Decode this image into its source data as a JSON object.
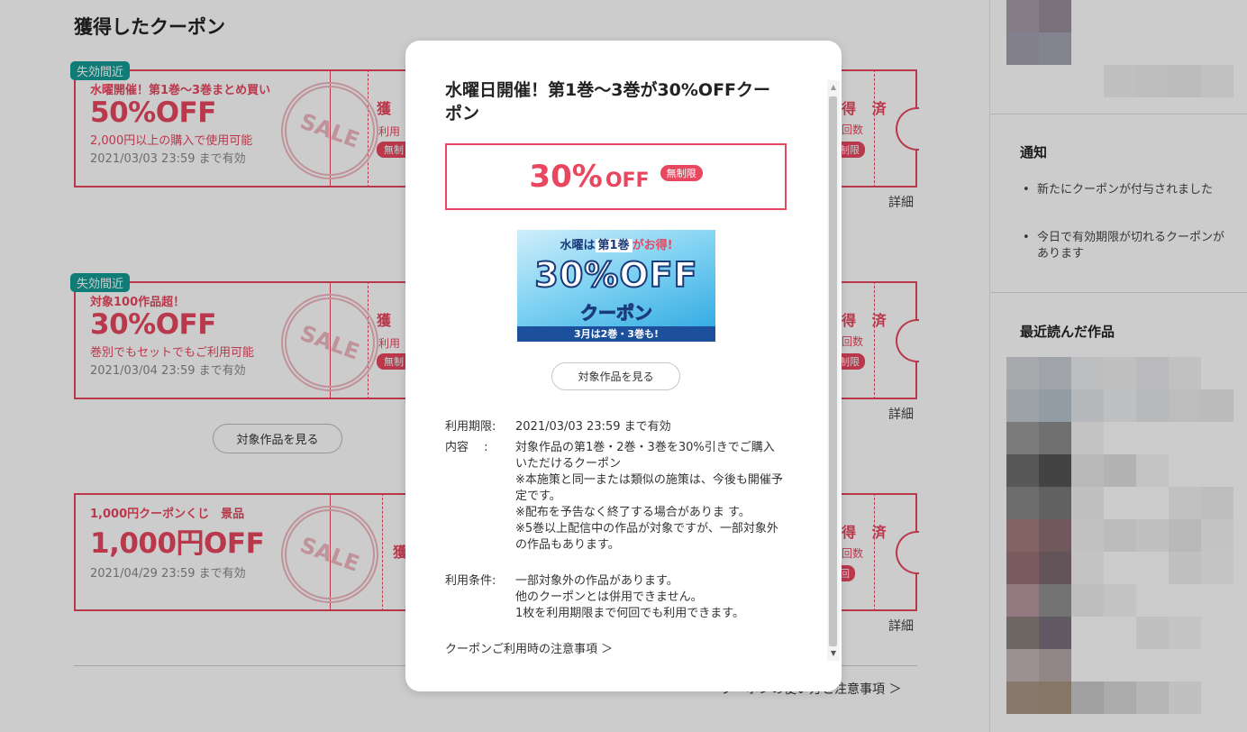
{
  "section_title": "獲得したクーポン",
  "coupons": [
    {
      "badge": "失効間近",
      "label": "水曜開催！第1巻〜3巻まとめ買い",
      "discount": "50%OFF",
      "condition": "2,000円以上の購入で使用可能",
      "expiry": "2021/03/03 23:59 まで有効",
      "acquired": "獲 得",
      "acquired_sub": "利用",
      "acquired_pill": "無制",
      "done": "得 済",
      "done_sub": "回数",
      "done_pill": "制限",
      "detail": "詳細"
    },
    {
      "badge": "失効間近",
      "label": "対象100作品超！",
      "discount": "30%OFF",
      "condition": "巻別でもセットでもご利用可能",
      "expiry": "2021/03/04 23:59 まで有効",
      "acquired": "獲 得",
      "acquired_sub": "利用",
      "acquired_pill": "無制",
      "done": "得 済",
      "done_sub": "回数",
      "done_pill": "制限",
      "detail": "詳細"
    },
    {
      "label": "1,000円クーポンくじ　景品",
      "discount": "1,000円OFF",
      "expiry": "2021/04/29 23:59 まで有効",
      "acquired": "獲",
      "done": "得 済",
      "done_sub": "回数",
      "done_pill": "回",
      "detail": "詳細"
    }
  ],
  "stamp_text": "SALE",
  "view_works_button": "対象作品を見る",
  "usage_link": "クーポンの使い方と注意事項 ＞",
  "sidebar": {
    "notice_title": "通知",
    "notices": [
      "新たにクーポンが付与されました",
      "今日で有効期限が切れるクーポンがあります"
    ],
    "recent_title": "最近読んだ作品"
  },
  "modal": {
    "title": "水曜日開催！第1巻〜3巻が30%OFFクーポン",
    "percent": "30%",
    "off": "OFF",
    "pill": "無制限",
    "banner": {
      "top_a": "水曜",
      "top_b": "は",
      "top_c": "第1巻",
      "top_d": "がお得!",
      "main": "30%OFF",
      "sub": "クーポン",
      "foot": "3月は2巻・3巻も!"
    },
    "view_button": "対象作品を見る",
    "period_label": "利用期限:",
    "period_value": "2021/03/03 23:59 まで有効",
    "content_label": "内容　 :",
    "content_value": "対象作品の第1巻・2巻・3巻を30%引きでご購入いただけるクーポン\n※本施策と同一または類似の施策は、今後も開催予定です。\n※配布を予告なく終了する場合がありま す。\n※5巻以上配信中の作品が対象ですが、一部対象外の作品もあります。",
    "condition_label": "利用条件:",
    "condition_value": "一部対象外の作品があります。\n他のクーポンとは併用できません。\n1枚を利用期限まで何回でも利用できます。",
    "note_link": "クーポンご利用時の注意事項 ＞"
  },
  "colors": {
    "accent": "#e8475f",
    "badge": "#149b96",
    "overlay": "rgba(0,0,0,0.2)"
  }
}
